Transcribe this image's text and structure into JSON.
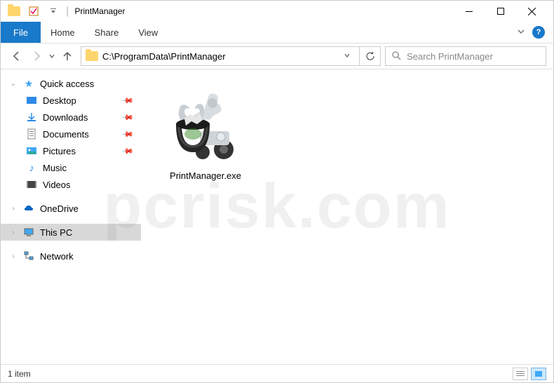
{
  "titlebar": {
    "title": "PrintManager"
  },
  "ribbon": {
    "file": "File",
    "tabs": [
      "Home",
      "Share",
      "View"
    ]
  },
  "address": {
    "path": "C:\\ProgramData\\PrintManager"
  },
  "search": {
    "placeholder": "Search PrintManager"
  },
  "sidebar": {
    "quick_access": "Quick access",
    "items": [
      {
        "label": "Desktop"
      },
      {
        "label": "Downloads"
      },
      {
        "label": "Documents"
      },
      {
        "label": "Pictures"
      },
      {
        "label": "Music"
      },
      {
        "label": "Videos"
      }
    ],
    "onedrive": "OneDrive",
    "thispc": "This PC",
    "network": "Network"
  },
  "files": [
    {
      "name": "PrintManager.exe"
    }
  ],
  "status": {
    "count": "1 item"
  },
  "watermark": "pcrisk.com"
}
